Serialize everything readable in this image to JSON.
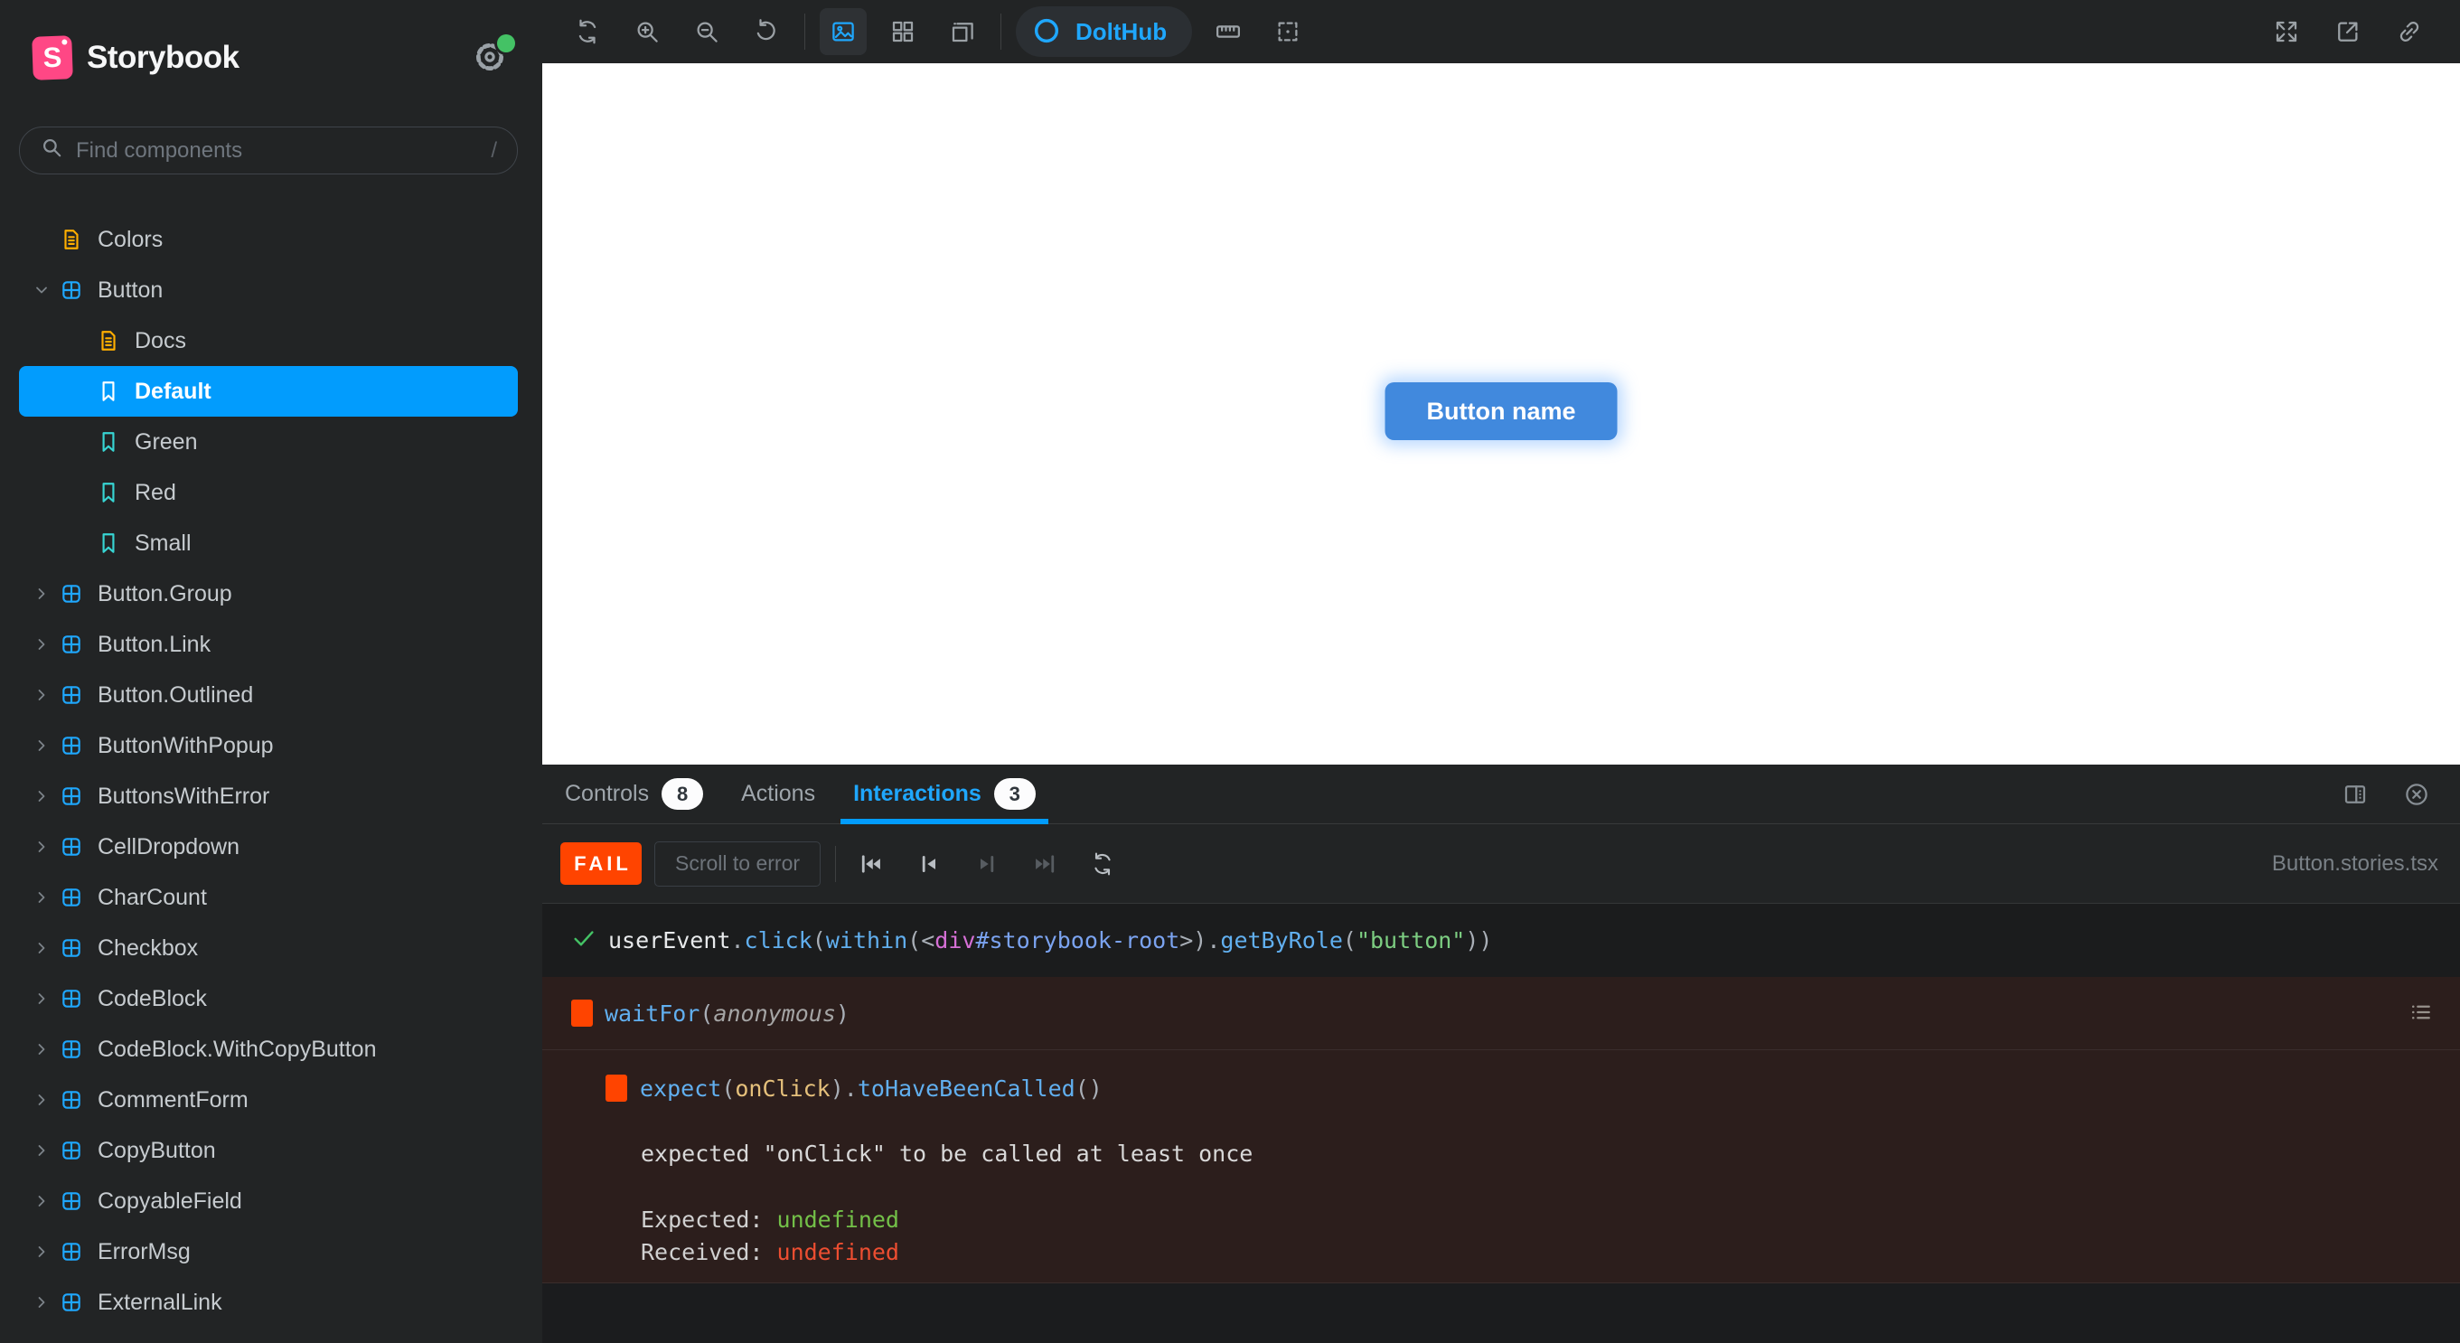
{
  "colors": {
    "accent": "#029CFD",
    "accent-text": "#1FA7FD",
    "brand": "#FF4785",
    "gold": "#FFAE00",
    "teal": "#37D5D3",
    "fail": "#FF4400",
    "pass": "#44C265",
    "story-button": "#4189DD",
    "expected": "#73C048",
    "received": "#ED4E31"
  },
  "sidebar": {
    "brand": "Storybook",
    "gear_icon": "gear",
    "notification_dot_color": "#66BF3C",
    "search": {
      "placeholder": "Find components",
      "shortcut": "/",
      "icon": "search"
    },
    "tree": [
      {
        "label": "Colors",
        "type": "doc",
        "depth": 0
      },
      {
        "label": "Button",
        "type": "component",
        "depth": 0,
        "expanded": true
      },
      {
        "label": "Docs",
        "type": "doc",
        "depth": 1
      },
      {
        "label": "Default",
        "type": "story",
        "depth": 1,
        "selected": true
      },
      {
        "label": "Green",
        "type": "story",
        "depth": 1
      },
      {
        "label": "Red",
        "type": "story",
        "depth": 1
      },
      {
        "label": "Small",
        "type": "story",
        "depth": 1
      },
      {
        "label": "Button.Group",
        "type": "component",
        "depth": 0
      },
      {
        "label": "Button.Link",
        "type": "component",
        "depth": 0
      },
      {
        "label": "Button.Outlined",
        "type": "component",
        "depth": 0
      },
      {
        "label": "ButtonWithPopup",
        "type": "component",
        "depth": 0
      },
      {
        "label": "ButtonsWithError",
        "type": "component",
        "depth": 0
      },
      {
        "label": "CellDropdown",
        "type": "component",
        "depth": 0
      },
      {
        "label": "CharCount",
        "type": "component",
        "depth": 0
      },
      {
        "label": "Checkbox",
        "type": "component",
        "depth": 0
      },
      {
        "label": "CodeBlock",
        "type": "component",
        "depth": 0
      },
      {
        "label": "CodeBlock.WithCopyButton",
        "type": "component",
        "depth": 0
      },
      {
        "label": "CommentForm",
        "type": "component",
        "depth": 0
      },
      {
        "label": "CopyButton",
        "type": "component",
        "depth": 0
      },
      {
        "label": "CopyableField",
        "type": "component",
        "depth": 0
      },
      {
        "label": "ErrorMsg",
        "type": "component",
        "depth": 0
      },
      {
        "label": "ExternalLink",
        "type": "component",
        "depth": 0
      }
    ]
  },
  "toolbar": {
    "group_zoom": [
      "refresh",
      "zoom-in",
      "zoom-out",
      "zoom-reset"
    ],
    "group_view": [
      {
        "name": "image",
        "active": true
      },
      "grid",
      "stacked"
    ],
    "group_measure": [
      "ruler",
      "outline"
    ],
    "dolthub": {
      "label": "DoltHub",
      "icon": "circle"
    },
    "right_icons": [
      "fullscreen",
      "export",
      "link"
    ]
  },
  "canvas": {
    "button_label": "Button name"
  },
  "panel": {
    "tabs": [
      {
        "label": "Controls",
        "badge": "8"
      },
      {
        "label": "Actions"
      },
      {
        "label": "Interactions",
        "badge": "3",
        "active": true
      }
    ],
    "right_icons": [
      "panel-position",
      "close"
    ],
    "toolbar": {
      "status": "FAIL",
      "scroll_button": "Scroll to error",
      "playback_icons": [
        {
          "name": "go-start",
          "enabled": true
        },
        {
          "name": "step-back",
          "enabled": true
        },
        {
          "name": "step-forward",
          "enabled": false
        },
        {
          "name": "go-end",
          "enabled": false
        },
        {
          "name": "rerun",
          "enabled": true
        }
      ],
      "filename": "Button.stories.tsx"
    },
    "interactions": {
      "pass_row": {
        "tokens": [
          [
            "userEvent",
            "plain"
          ],
          [
            ".",
            "punct"
          ],
          [
            "click",
            "fn"
          ],
          [
            "(",
            "punct"
          ],
          [
            "within",
            "fn"
          ],
          [
            "(",
            "punct"
          ],
          [
            "<",
            "punct"
          ],
          [
            "div",
            "tag"
          ],
          [
            "#storybook-root",
            "id"
          ],
          [
            ">",
            "punct"
          ],
          [
            ").",
            "punct"
          ],
          [
            "getByRole",
            "fn"
          ],
          [
            "(",
            "punct"
          ],
          [
            "\"button\"",
            "str"
          ],
          [
            "))",
            "punct"
          ]
        ]
      },
      "fail_group_row": {
        "tokens": [
          [
            "waitFor",
            "fn"
          ],
          [
            "(",
            "punct"
          ],
          [
            "anonymous",
            "anon"
          ],
          [
            ")",
            "punct"
          ]
        ],
        "trailing_icon": "list"
      },
      "fail_assert_row": {
        "tokens": [
          [
            "expect",
            "fn"
          ],
          [
            "(",
            "punct"
          ],
          [
            "onClick",
            "arg"
          ],
          [
            ")",
            "punct"
          ],
          [
            ".",
            "punct"
          ],
          [
            "toHaveBeenCalled",
            "fn"
          ],
          [
            "()",
            "punct"
          ]
        ],
        "message": "expected \"onClick\" to be called at least once",
        "expected_label": "Expected: ",
        "expected_value": "undefined",
        "received_label": "Received: ",
        "received_value": "undefined"
      }
    }
  }
}
